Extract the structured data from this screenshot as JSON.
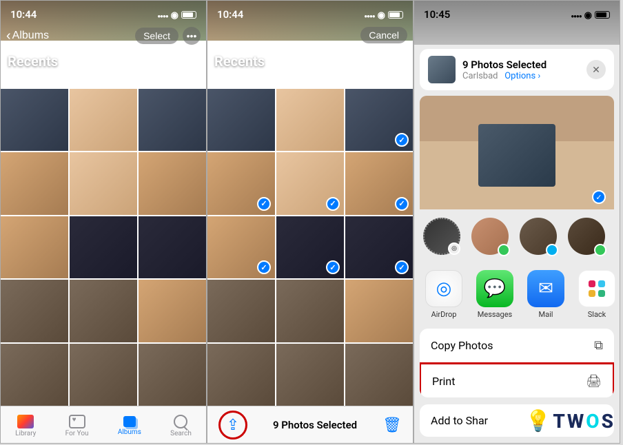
{
  "screen1": {
    "time": "10:44",
    "back_label": "Albums",
    "select_label": "Select",
    "section": "Recents",
    "tabs": [
      {
        "label": "Library"
      },
      {
        "label": "For You"
      },
      {
        "label": "Albums"
      },
      {
        "label": "Search"
      }
    ]
  },
  "screen2": {
    "time": "10:44",
    "cancel_label": "Cancel",
    "section": "Recents",
    "selected_count": "9 Photos Selected"
  },
  "screen3": {
    "time": "10:45",
    "header_title": "9 Photos Selected",
    "header_subtitle_location": "Carlsbad",
    "header_options": "Options",
    "apps": [
      {
        "label": "AirDrop"
      },
      {
        "label": "Messages"
      },
      {
        "label": "Mail"
      },
      {
        "label": "Slack"
      }
    ],
    "actions": {
      "copy": "Copy Photos",
      "print": "Print",
      "add_to_share": "Add to Shar"
    }
  },
  "watermark": {
    "t": "T",
    "w": "W",
    "o": "O",
    "s": "S"
  }
}
